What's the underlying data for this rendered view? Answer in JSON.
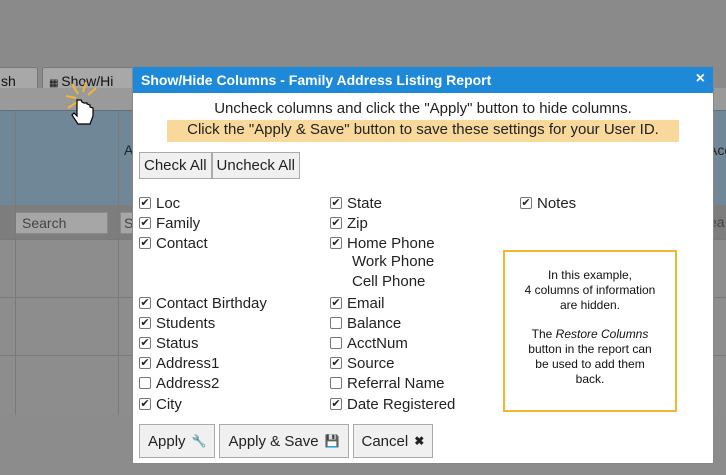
{
  "background": {
    "toolbar": {
      "refresh_label": "sh",
      "show_hide_label": "Show/Hi"
    },
    "search_placeholder": "Search",
    "search_partial": "S",
    "header_a": "A",
    "header_acc": "Acc",
    "ea": "ea"
  },
  "modal": {
    "title": "Show/Hide Columns - Family Address Listing Report",
    "close_icon": "×",
    "message_line1": "Uncheck columns and click the \"Apply\" button to hide columns.",
    "message_line2": "Click the \"Apply & Save\" button to save these settings for your User ID.",
    "check_all_label": "Check All",
    "uncheck_all_label": "Uncheck All",
    "columns": {
      "col1": [
        {
          "label": "Loc",
          "checked": true
        },
        {
          "label": "Family",
          "checked": true
        },
        {
          "label": "Contact",
          "checked": true
        },
        {
          "label": "Contact Birthday",
          "checked": true
        },
        {
          "label": "Students",
          "checked": true
        },
        {
          "label": "Status",
          "checked": true
        },
        {
          "label": "Address1",
          "checked": true
        },
        {
          "label": "Address2",
          "checked": false
        },
        {
          "label": "City",
          "checked": true
        }
      ],
      "col2": [
        {
          "label": "State",
          "checked": true
        },
        {
          "label": "Zip",
          "checked": true
        },
        {
          "label": "Home Phone",
          "checked": true
        },
        {
          "label": "Work Phone"
        },
        {
          "label": "Cell Phone"
        },
        {
          "label": "Email",
          "checked": true
        },
        {
          "label": "Balance",
          "checked": false
        },
        {
          "label": "AcctNum",
          "checked": false
        },
        {
          "label": "Source",
          "checked": true
        },
        {
          "label": "Referral Name",
          "checked": false
        },
        {
          "label": "Date Registered",
          "checked": true
        }
      ],
      "col3": [
        {
          "label": "Notes",
          "checked": true
        }
      ]
    },
    "note": {
      "line1": "In this example,",
      "line2": "4 columns of information",
      "line3": "are hidden.",
      "line4_prefix": "The ",
      "line4_em": "Restore Columns",
      "line5": "button in the report can",
      "line6": "be used to add them",
      "line7": "back."
    },
    "apply_label": "Apply",
    "apply_save_label": "Apply & Save",
    "cancel_label": "Cancel"
  },
  "colors": {
    "title_bar": "#1e88d9",
    "highlight": "#f9d99b",
    "note_border": "#f2b632"
  }
}
